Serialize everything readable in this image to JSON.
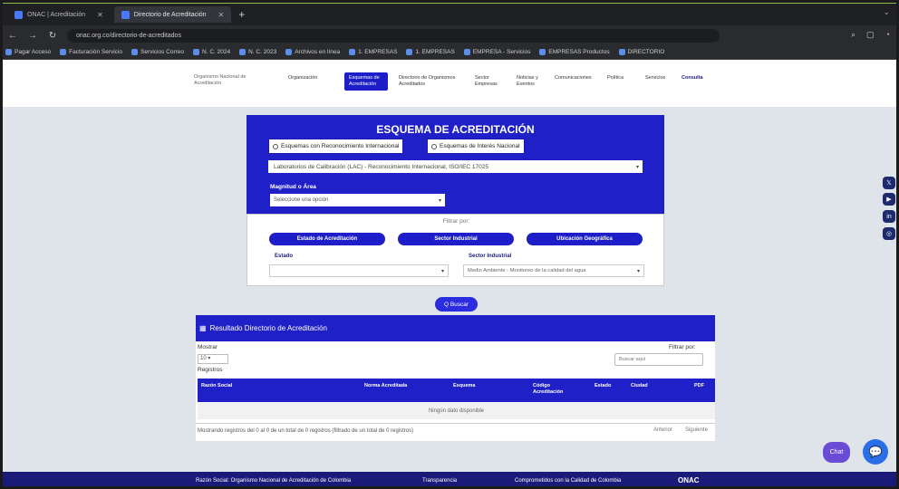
{
  "browser": {
    "tabs": [
      {
        "label": "ONAC | Acreditación",
        "active": false
      },
      {
        "label": "Directorio de Acreditación",
        "active": true
      }
    ],
    "url": "onac.org.co/directorio-de-acreditados",
    "bookmarks": [
      "Pagar Acceso",
      "Facturación Servicio",
      "Servicios Correo",
      "N. C. 2024",
      "N. C. 2023",
      "Archivos en línea",
      "1. EMPRESAS",
      "1. EMPRESAS",
      "EMPRESA - Servicios",
      "EMPRESAS Productos",
      "DIRECTORIO"
    ]
  },
  "site_nav": {
    "brand": "Organismo Nacional de Acreditación",
    "items": [
      "Organización",
      "Esquemas de Acreditación",
      "Directorio de Organismos Acreditados",
      "Sector Empresas",
      "Noticias y Eventos",
      "Comunicaciones",
      "Política",
      "Servicios",
      "Consulta"
    ]
  },
  "card": {
    "title": "ESQUEMA DE ACREDITACIÓN",
    "radio_international": "Esquemas con Reconocimiento Internacional",
    "radio_national": "Esquemas de Interés Nacional",
    "scheme_value": "Laboratorios de Calibración (LAC) - Reconocimiento Internacional, ISO/IEC 17025",
    "area_label": "Magnitud o Área",
    "area_value": "Seleccione una opción",
    "filter_label": "Filtrar por:",
    "pill_state": "Estado de Acreditación",
    "pill_sector": "Sector Industrial",
    "pill_location": "Ubicación Geográfica",
    "state_label": "Estado",
    "sector_label": "Sector Industrial",
    "sector_value": "Medio Ambiente - Monitoreo de la calidad del agua"
  },
  "buscar_label": "Q Buscar",
  "results": {
    "title": "Resultado Directorio de Acreditación",
    "show_label": "Mostrar",
    "show_value": "10",
    "records_label": "Registros",
    "filter_label": "Filtrar por:",
    "search_placeholder": "Buscar aquí",
    "columns": [
      "Razón Social",
      "Norma Acreditada",
      "Esquema",
      "Código Acreditación",
      "Estado",
      "Ciudad",
      "PDF"
    ],
    "empty_message": "Ningún dato disponible",
    "info": "Mostrando registros del 0 al 0 de un total de 0 registros (filtrado de un total de 0 registros)",
    "prev": "Anterior",
    "next": "Siguiente"
  },
  "chat_badge": "Chat",
  "footer": {
    "left": "Razón Social: Organismo Nacional de Acreditación de Colombia",
    "center": "Transparencia",
    "right": "Comprometidos con la Calidad de Colombia",
    "brand": "ONAC"
  }
}
